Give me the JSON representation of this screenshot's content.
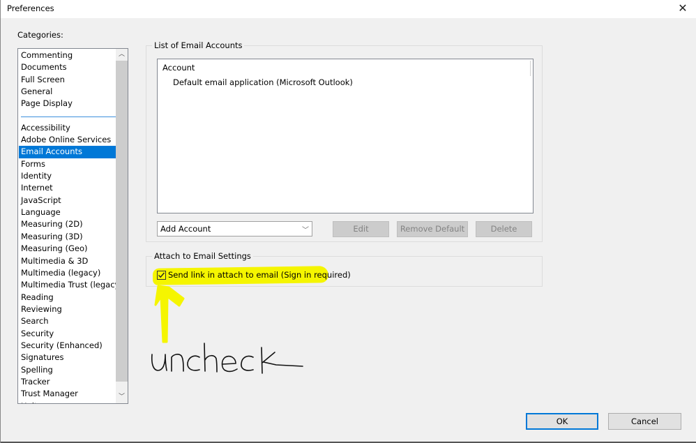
{
  "window": {
    "title": "Preferences",
    "close_icon": "close-icon"
  },
  "categories": {
    "label": "Categories:",
    "top_items": [
      "Commenting",
      "Documents",
      "Full Screen",
      "General",
      "Page Display"
    ],
    "items": [
      "Accessibility",
      "Adobe Online Services",
      "Email Accounts",
      "Forms",
      "Identity",
      "Internet",
      "JavaScript",
      "Language",
      "Measuring (2D)",
      "Measuring (3D)",
      "Measuring (Geo)",
      "Multimedia & 3D",
      "Multimedia (legacy)",
      "Multimedia Trust (legacy)",
      "Reading",
      "Reviewing",
      "Search",
      "Security",
      "Security (Enhanced)",
      "Signatures",
      "Spelling",
      "Tracker",
      "Trust Manager",
      "Units"
    ],
    "selected": "Email Accounts",
    "scroll_up_icon": "chevron-up-icon",
    "scroll_down_icon": "chevron-down-icon"
  },
  "email_accounts": {
    "group_label": "List of Email Accounts",
    "column_header": "Account",
    "rows": [
      "Default email application (Microsoft Outlook)"
    ],
    "add_account": {
      "selected": "Add Account"
    },
    "buttons": {
      "edit": "Edit",
      "remove_default": "Remove Default",
      "delete": "Delete"
    }
  },
  "attach_settings": {
    "group_label": "Attach to Email Settings",
    "send_link_label": "Send link in attach to email (Sign in required)",
    "send_link_checked": true
  },
  "annotation": {
    "text": "uncheck",
    "highlight_color": "#f5f500"
  },
  "footer": {
    "ok": "OK",
    "cancel": "Cancel"
  },
  "colors": {
    "selection": "#0078d7",
    "dialog_bg": "#f0f0f0"
  }
}
